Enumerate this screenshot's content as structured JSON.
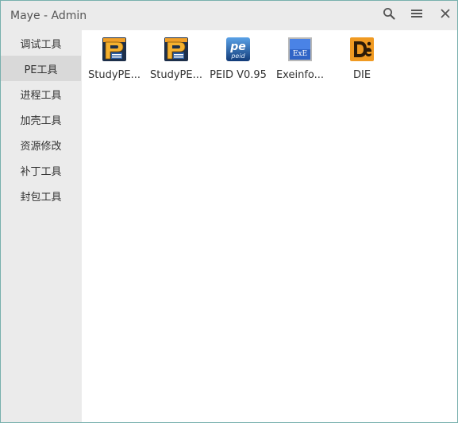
{
  "window": {
    "title": "Maye - Admin"
  },
  "titlebar": {
    "icons": [
      "search-icon",
      "menu-icon",
      "close-icon"
    ]
  },
  "sidebar": {
    "items": [
      {
        "label": "调试工具"
      },
      {
        "label": "PE工具",
        "active": true
      },
      {
        "label": "进程工具"
      },
      {
        "label": "加壳工具"
      },
      {
        "label": "资源修改"
      },
      {
        "label": "补丁工具"
      },
      {
        "label": "封包工具"
      }
    ]
  },
  "tools": [
    {
      "label": "StudyPE...",
      "icon": "studype-icon"
    },
    {
      "label": "StudyPE...",
      "icon": "studype-icon"
    },
    {
      "label": "PEID V0.95",
      "icon": "peid-icon"
    },
    {
      "label": "Exeinfo...",
      "icon": "exeinfo-icon"
    },
    {
      "label": "DIE",
      "icon": "die-icon"
    }
  ],
  "colors": {
    "accent_border": "#78b0ad",
    "active_item": "#d9d9d9",
    "content_bg": "#ffffff"
  }
}
